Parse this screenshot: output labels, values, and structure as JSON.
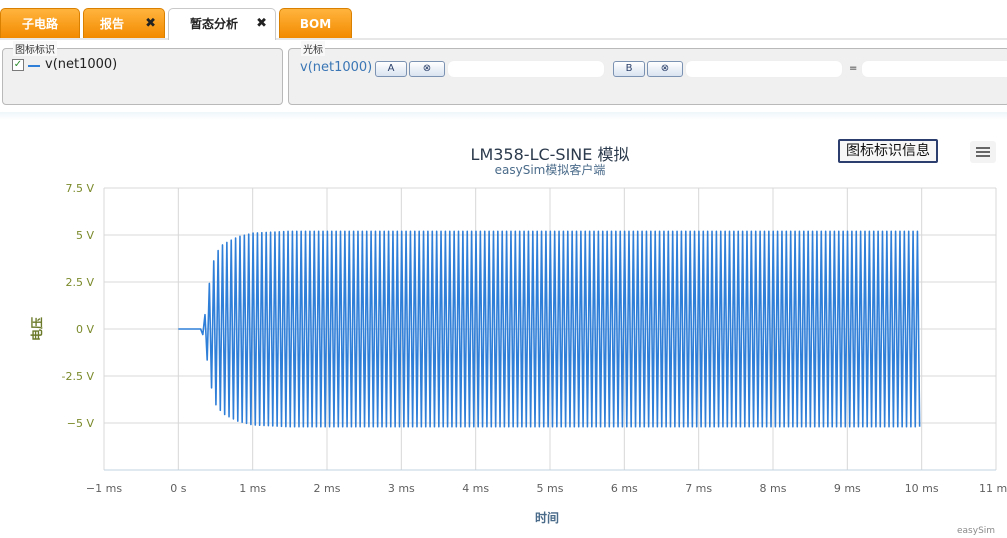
{
  "tabs": [
    {
      "label": "子电路",
      "active": false,
      "closable": false
    },
    {
      "label": "报告",
      "active": false,
      "closable": true
    },
    {
      "label": "暂态分析",
      "active": true,
      "closable": true
    },
    {
      "label": "BOM",
      "active": false,
      "closable": false
    }
  ],
  "close_glyph": "✖",
  "legend_panel": {
    "caption": "图标标识",
    "item_label": "v(net1000)",
    "checked": true,
    "series_color": "#2f7ed8"
  },
  "cursor_panel": {
    "caption": "光标",
    "trace_label": "v(net1000)",
    "button_a": "A",
    "button_b": "B",
    "clear_glyph": "⊗",
    "equals": "="
  },
  "chart_toolbar": {
    "legend_info_button": "图标标识信息",
    "menu_icon": "hamburger-icon"
  },
  "credits": "easySim",
  "chart_data": {
    "type": "line",
    "title": "LM358-LC-SINE 模拟",
    "subtitle": "easySim模拟客户端",
    "xlabel": "时间",
    "ylabel": "电压",
    "xlim": [
      -1,
      11
    ],
    "ylim": [
      -7.5,
      7.5
    ],
    "x_ticks": [
      -1,
      0,
      1,
      2,
      3,
      4,
      5,
      6,
      7,
      8,
      9,
      10,
      11
    ],
    "x_tick_labels": [
      "−1 ms",
      "0 s",
      "1 ms",
      "2 ms",
      "3 ms",
      "4 ms",
      "5 ms",
      "6 ms",
      "7 ms",
      "8 ms",
      "9 ms",
      "10 ms",
      "11 ms"
    ],
    "y_ticks": [
      -5,
      -2.5,
      0,
      2.5,
      5,
      7.5
    ],
    "y_tick_labels": [
      "−5 V",
      "-2.5 V",
      "0 V",
      "2.5 V",
      "5 V",
      "7.5 V"
    ],
    "grid": true,
    "series": [
      {
        "name": "v(net1000)",
        "color": "#2f7ed8",
        "description_points": {
          "x_ms": [
            0,
            0.3,
            0.35,
            0.4,
            0.45,
            0.5,
            0.6,
            0.8,
            1.0,
            1.5,
            2.0,
            5.0,
            10.0
          ],
          "envelope_v": [
            0,
            0,
            0.5,
            2.0,
            3.2,
            4.0,
            4.5,
            4.9,
            5.1,
            5.2,
            5.2,
            5.2,
            5.2
          ]
        },
        "oscillation_period_ms": 0.0588
      }
    ]
  }
}
